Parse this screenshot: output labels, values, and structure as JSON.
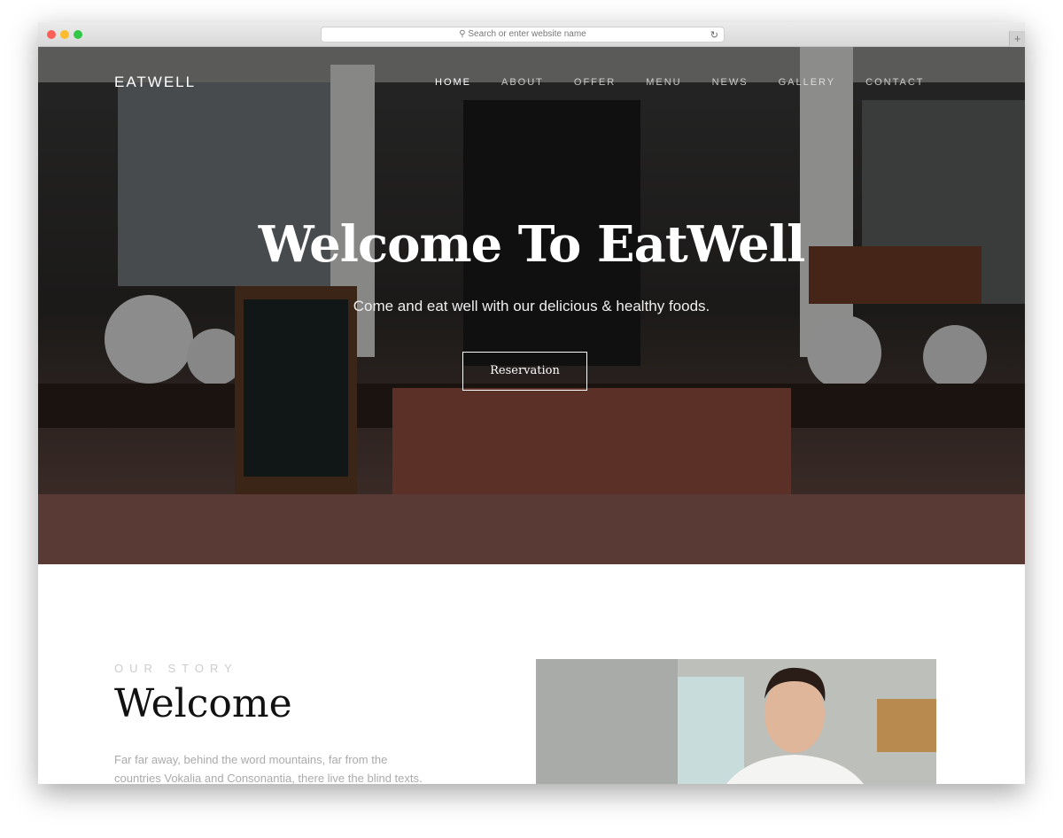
{
  "browser": {
    "url_placeholder": "Search or enter website name",
    "traffic_lights": [
      "#fc5f57",
      "#fdbc2e",
      "#33c748"
    ]
  },
  "site": {
    "logo": "EATWELL",
    "nav": [
      {
        "label": "HOME",
        "active": true
      },
      {
        "label": "ABOUT"
      },
      {
        "label": "OFFER"
      },
      {
        "label": "MENU"
      },
      {
        "label": "NEWS"
      },
      {
        "label": "GALLERY"
      },
      {
        "label": "CONTACT"
      }
    ],
    "hero": {
      "title": "Welcome To EatWell",
      "subtitle": "Come and eat well with our delicious & healthy foods.",
      "button": "Reservation"
    },
    "story": {
      "kicker": "OUR STORY",
      "title": "Welcome",
      "text": "Far far away, behind the word mountains, far from the countries Vokalia and Consonantia, there live the blind texts."
    }
  }
}
